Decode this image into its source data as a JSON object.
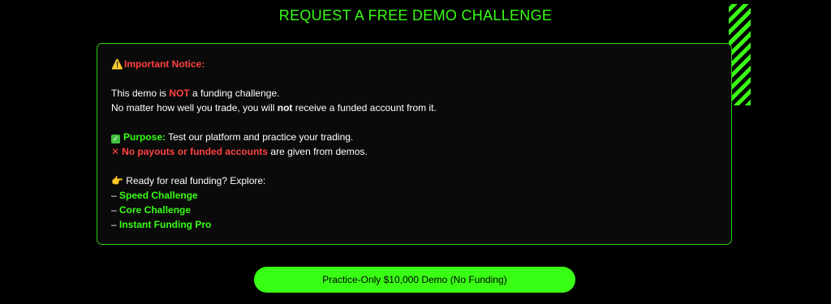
{
  "title": "REQUEST A FREE DEMO CHALLENGE",
  "notice": {
    "heading_icon": "⚠️",
    "heading": "Important Notice:",
    "line1_pre": "This demo is ",
    "line1_em": "NOT",
    "line1_post": " a funding challenge.",
    "line2_pre": "No matter how well you trade, you will ",
    "line2_em": "not",
    "line2_post": " receive a funded account from it.",
    "purpose_icon": "✓",
    "purpose_label": "Purpose:",
    "purpose_text": " Test our platform and practice your trading.",
    "nopay_icon": "✕",
    "nopay_label": "No payouts or funded accounts",
    "nopay_text": " are given from demos.",
    "explore_icon": "👉",
    "explore_text": " Ready for real funding? Explore:",
    "dash": "– ",
    "links": [
      "Speed Challenge",
      "Core Challenge",
      "Instant Funding Pro"
    ]
  },
  "cta": {
    "label": "Practice-Only $10,000 Demo (No Funding)"
  },
  "colors": {
    "accent": "#39ff14",
    "warning": "#ff4040",
    "background": "#000000"
  },
  "icons": {
    "warning": "warning-icon",
    "check": "checkmark-icon",
    "cross": "cross-icon",
    "pointer": "pointing-hand-icon"
  }
}
